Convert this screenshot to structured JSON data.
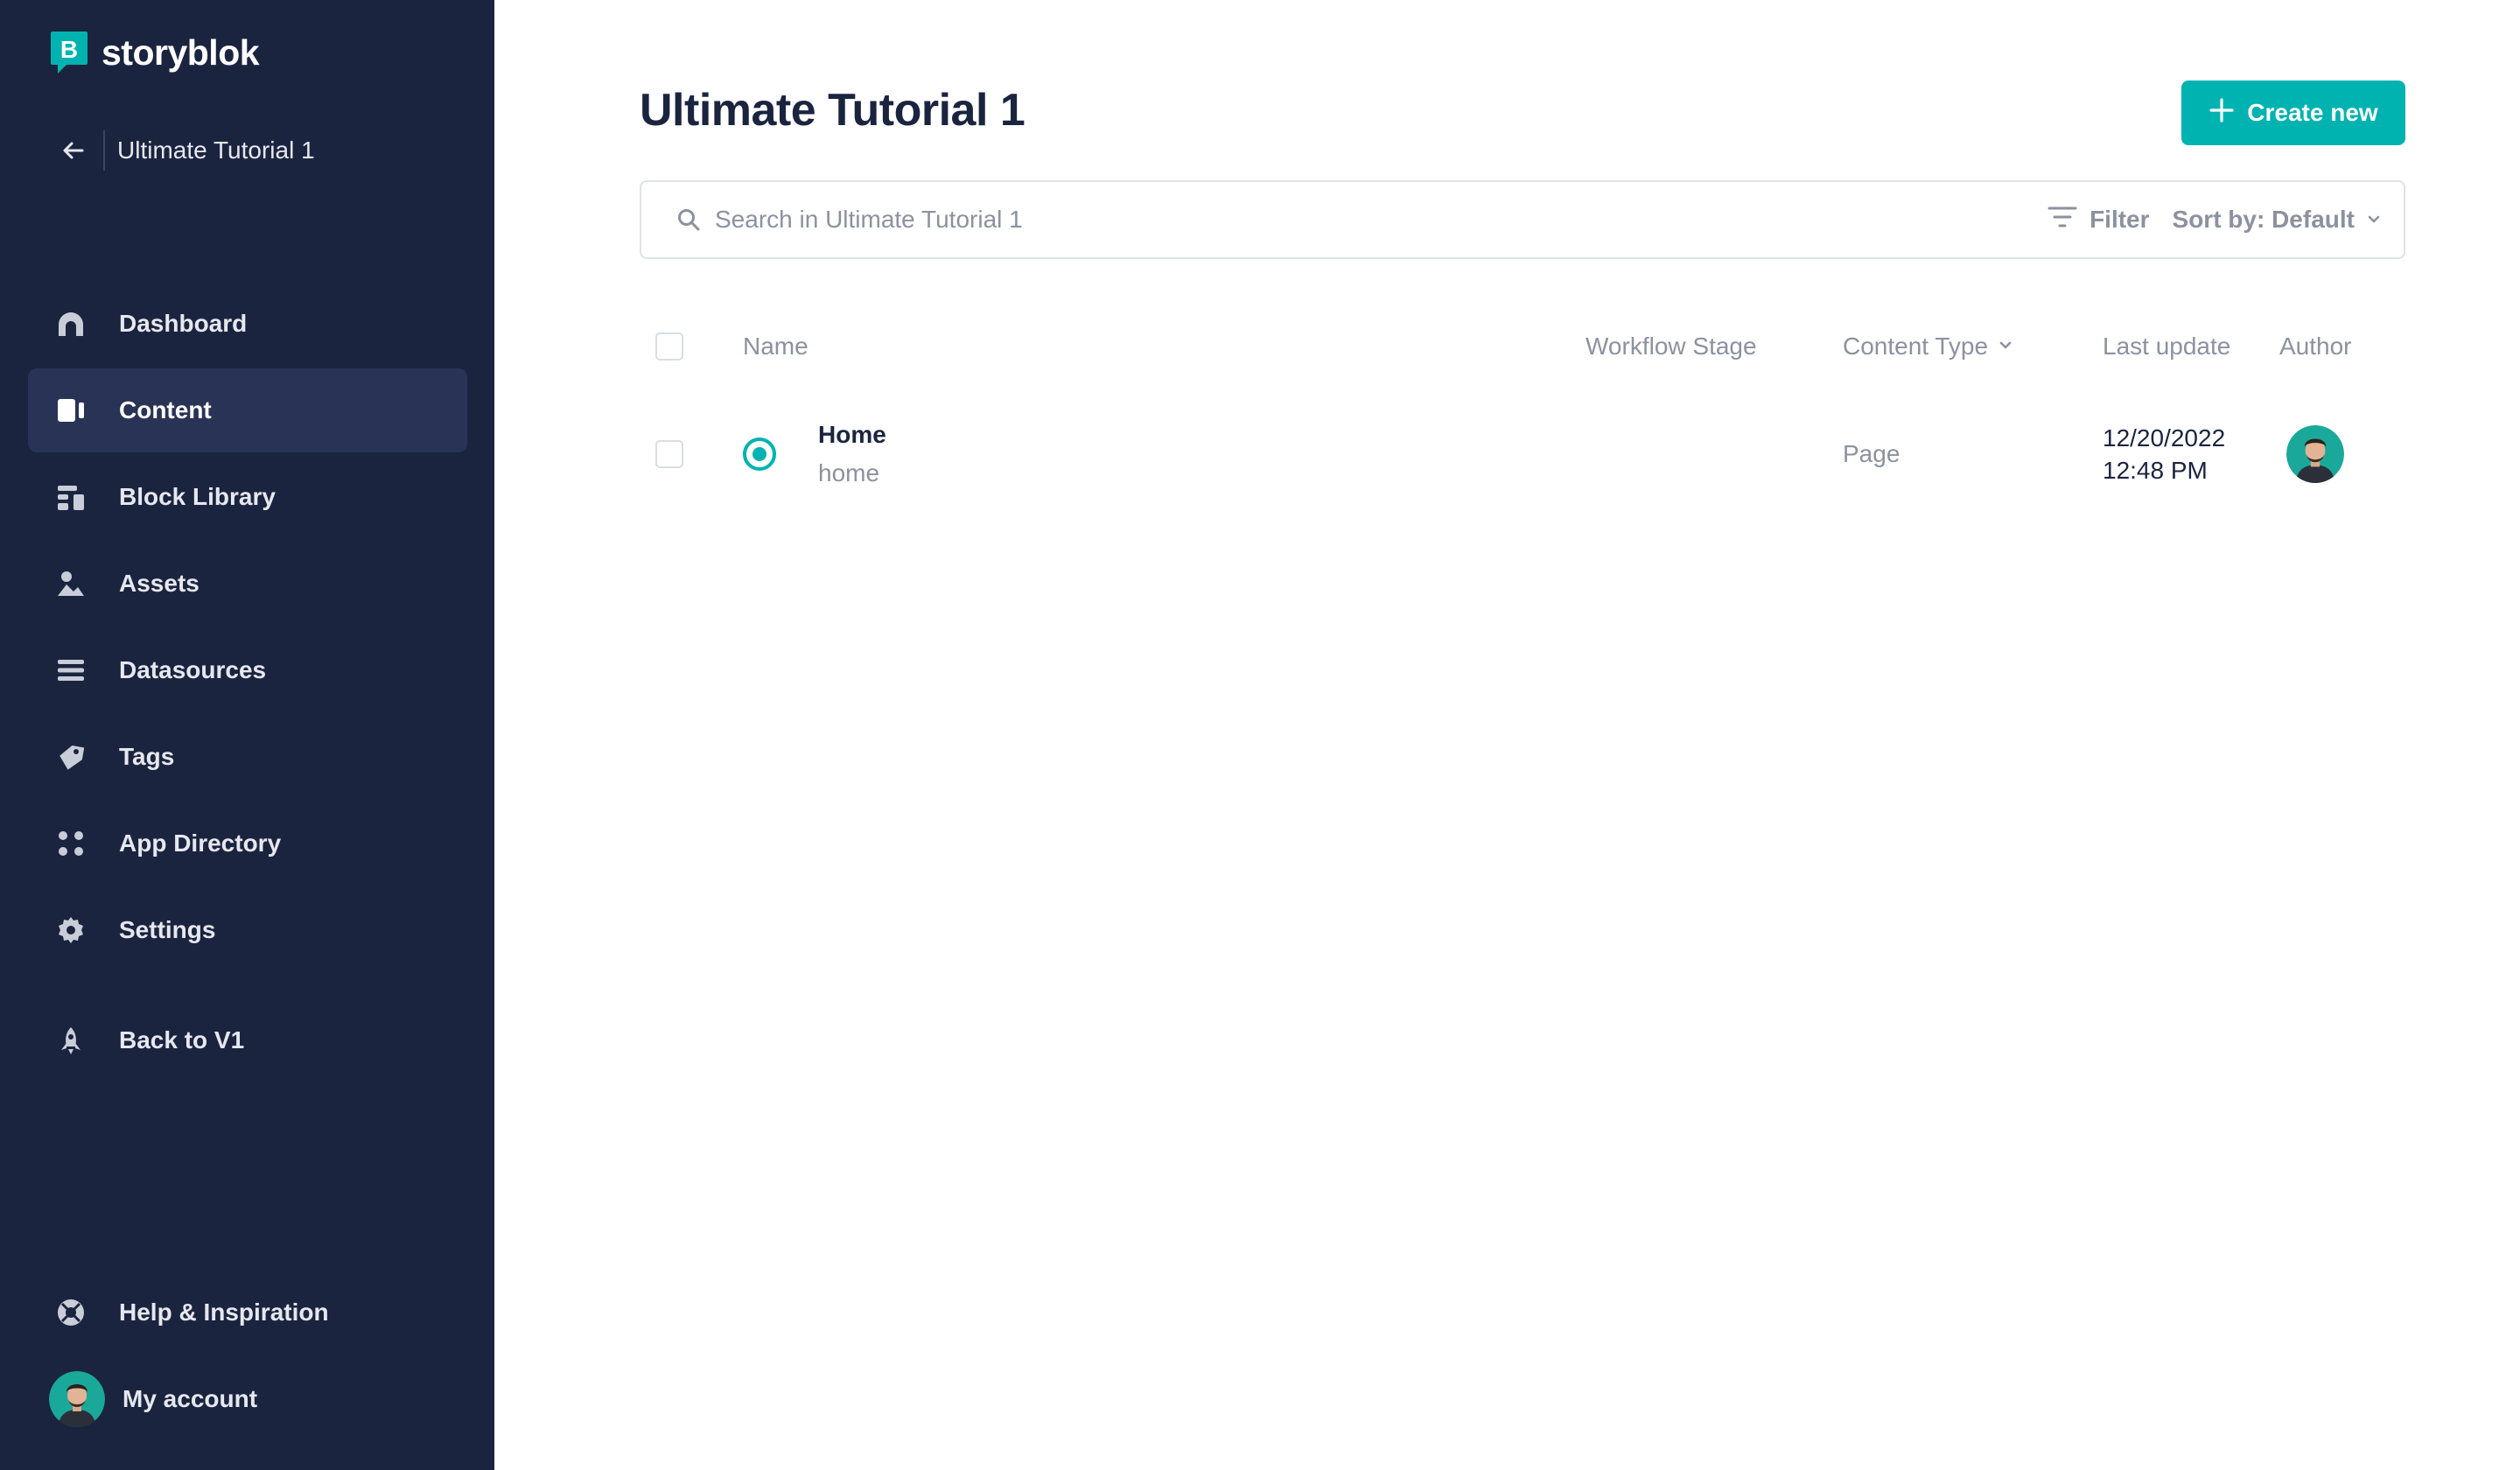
{
  "brand": {
    "name": "storyblok"
  },
  "project": {
    "name": "Ultimate Tutorial 1"
  },
  "nav": {
    "items": [
      {
        "label": "Dashboard",
        "icon": "dashboard-icon"
      },
      {
        "label": "Content",
        "icon": "content-icon",
        "active": true
      },
      {
        "label": "Block Library",
        "icon": "block-library-icon"
      },
      {
        "label": "Assets",
        "icon": "assets-icon"
      },
      {
        "label": "Datasources",
        "icon": "datasources-icon"
      },
      {
        "label": "Tags",
        "icon": "tag-icon"
      },
      {
        "label": "App Directory",
        "icon": "app-directory-icon"
      },
      {
        "label": "Settings",
        "icon": "gear-icon"
      },
      {
        "label": "Back to V1",
        "icon": "rocket-icon"
      }
    ],
    "help_label": "Help & Inspiration",
    "account_label": "My account"
  },
  "main": {
    "title": "Ultimate Tutorial 1",
    "create_label": "Create new",
    "search_placeholder": "Search in Ultimate Tutorial 1",
    "filter_label": "Filter",
    "sort_label": "Sort by: Default"
  },
  "table": {
    "columns": {
      "name": "Name",
      "workflow": "Workflow Stage",
      "content_type": "Content Type",
      "last_update": "Last update",
      "author": "Author"
    },
    "rows": [
      {
        "name": "Home",
        "slug": "home",
        "workflow": "",
        "content_type": "Page",
        "date": "12/20/2022",
        "time": "12:48 PM"
      }
    ]
  },
  "colors": {
    "sidebar_bg": "#1b243f",
    "accent": "#00b3b0",
    "active_item_bg": "#283355"
  }
}
